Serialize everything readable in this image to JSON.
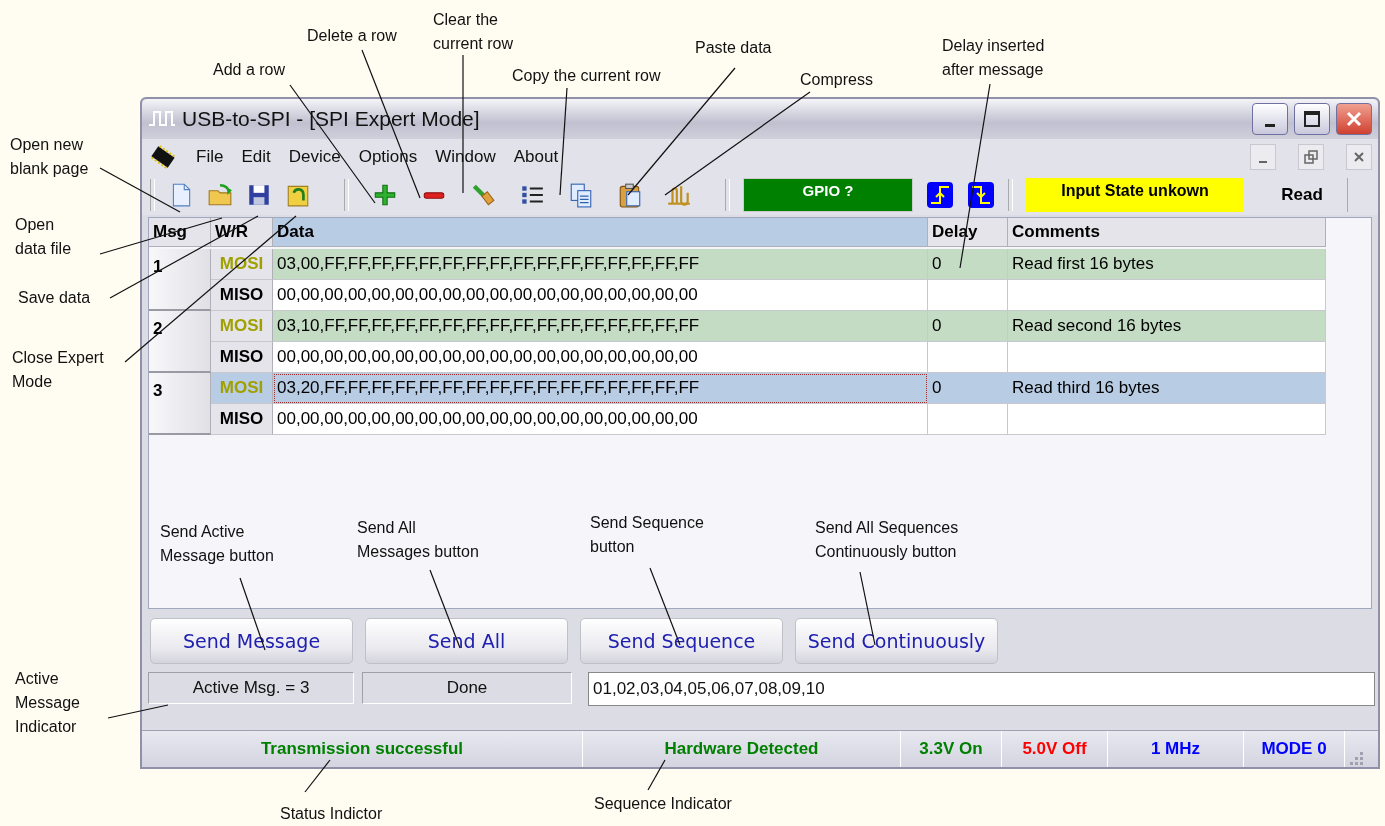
{
  "window": {
    "title": "USB-to-SPI - [SPI Expert Mode]"
  },
  "menu": [
    "File",
    "Edit",
    "Device",
    "Options",
    "Window",
    "About"
  ],
  "toolbar": {
    "gpio": "GPIO ?",
    "input_state": "Input State unkown",
    "read": "Read"
  },
  "table": {
    "columns": [
      {
        "label": "Msg",
        "selected": false
      },
      {
        "label": "W/R",
        "selected": false
      },
      {
        "label": "Data",
        "selected": true
      },
      {
        "label": "Delay",
        "selected": false
      },
      {
        "label": "Comments",
        "selected": false
      }
    ],
    "messages": [
      {
        "number": "1",
        "selected": false,
        "mosi": {
          "label": "MOSI",
          "data": "03,00,FF,FF,FF,FF,FF,FF,FF,FF,FF,FF,FF,FF,FF,FF,FF,FF",
          "delay": "0",
          "comment": "Read first 16 bytes"
        },
        "miso": {
          "label": "MISO",
          "data": "00,00,00,00,00,00,00,00,00,00,00,00,00,00,00,00,00,00"
        }
      },
      {
        "number": "2",
        "selected": false,
        "mosi": {
          "label": "MOSI",
          "data": "03,10,FF,FF,FF,FF,FF,FF,FF,FF,FF,FF,FF,FF,FF,FF,FF,FF",
          "delay": "0",
          "comment": "Read second 16 bytes"
        },
        "miso": {
          "label": "MISO",
          "data": "00,00,00,00,00,00,00,00,00,00,00,00,00,00,00,00,00,00"
        }
      },
      {
        "number": "3",
        "selected": true,
        "mosi": {
          "label": "MOSI",
          "data": "03,20,FF,FF,FF,FF,FF,FF,FF,FF,FF,FF,FF,FF,FF,FF,FF,FF",
          "delay": "0",
          "comment": "Read third 16 bytes"
        },
        "miso": {
          "label": "MISO",
          "data": "00,00,00,00,00,00,00,00,00,00,00,00,00,00,00,00,00,00"
        }
      }
    ]
  },
  "buttons": [
    "Send Message",
    "Send All",
    "Send Sequence",
    "Send Continuously"
  ],
  "indicators": {
    "active": "Active Msg. = 3",
    "state": "Done",
    "sequence": "01,02,03,04,05,06,07,08,09,10"
  },
  "status_bar": [
    {
      "text": "Transmission successful",
      "color": "#008000"
    },
    {
      "text": "Hardware Detected",
      "color": "#008000"
    },
    {
      "text": "3.3V On",
      "color": "#008000"
    },
    {
      "text": "5.0V Off",
      "color": "#ff0000"
    },
    {
      "text": "1 MHz",
      "color": "#0000ff"
    },
    {
      "text": "MODE 0",
      "color": "#0000ff"
    }
  ],
  "annotations": [
    "Add a row",
    "Delete a row",
    "Clear the\ncurrent row",
    "Copy the current row",
    "Paste data",
    "Compress",
    "Delay inserted\nafter message",
    "Open new\nblank page",
    "Open\ndata file",
    "Save data",
    "Close Expert\nMode",
    "Send Active\nMessage button",
    "Send All\nMessages button",
    "Send Sequence\nbutton",
    "Send All Sequences\nContinuously button",
    "Active\nMessage\nIndicator",
    "Status Indictor",
    "Sequence Indicator"
  ]
}
